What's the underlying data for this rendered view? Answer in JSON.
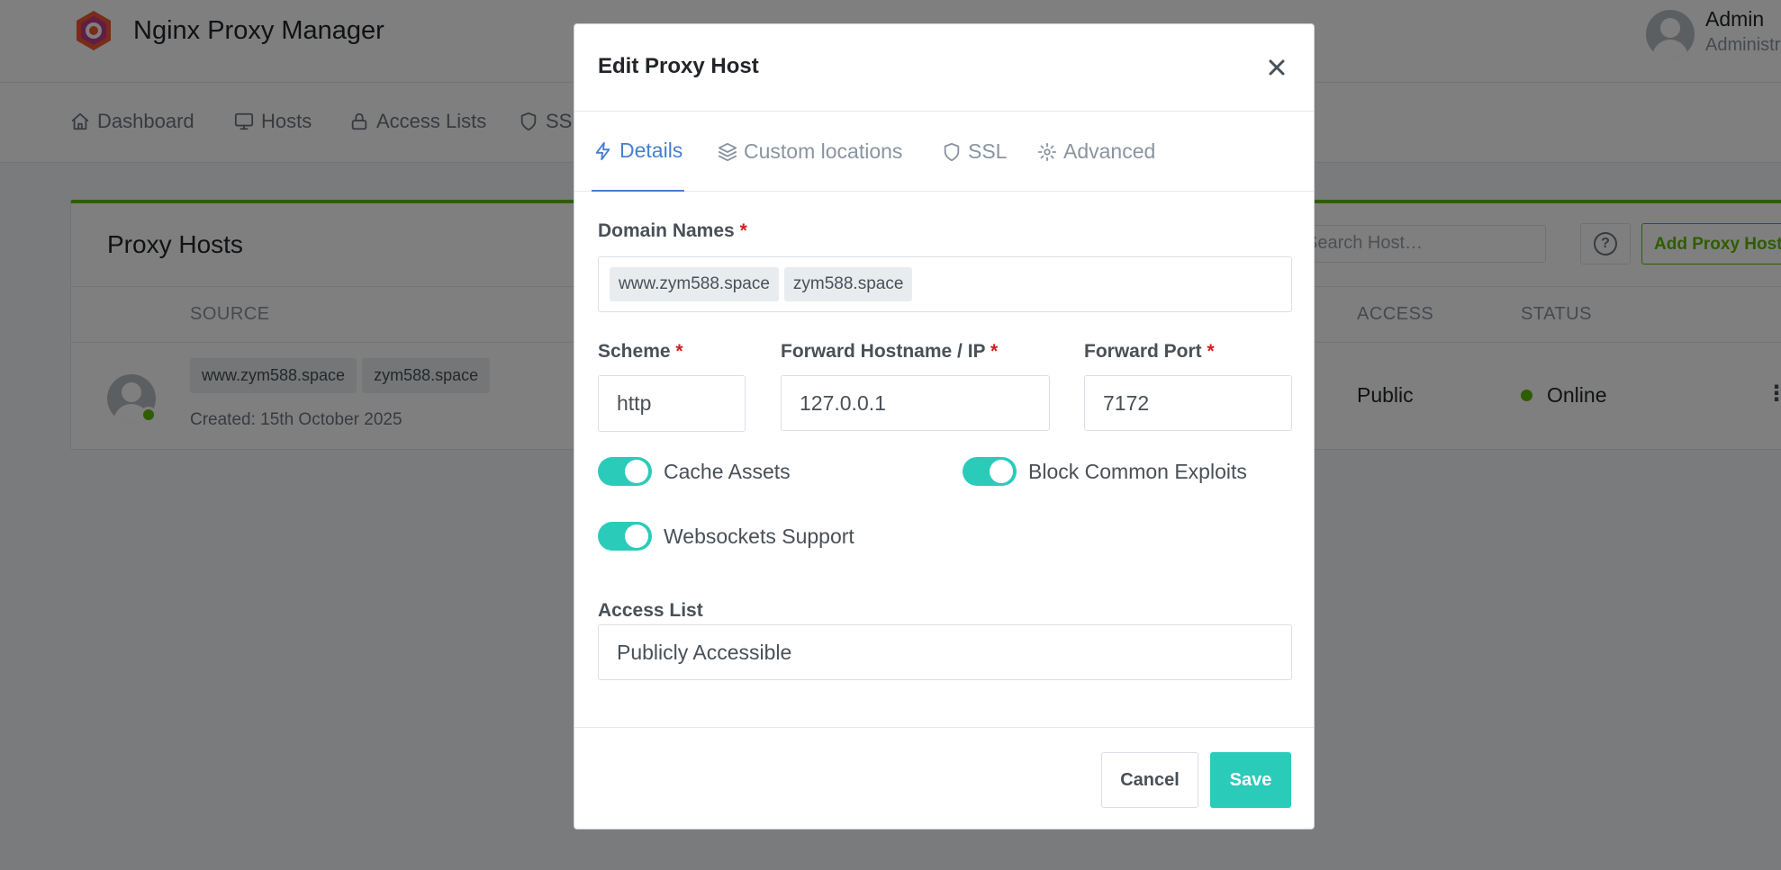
{
  "app": {
    "name": "Nginx Proxy Manager",
    "user": {
      "name": "Admin",
      "role": "Administrator"
    }
  },
  "nav": [
    {
      "label": "Dashboard",
      "icon": "home-icon"
    },
    {
      "label": "Hosts",
      "icon": "monitor-icon"
    },
    {
      "label": "Access Lists",
      "icon": "lock-icon"
    },
    {
      "label": "SSL",
      "icon": "shield-icon"
    }
  ],
  "card": {
    "title": "Proxy Hosts",
    "search_placeholder": "Search Host…",
    "help_label": "?",
    "add_label": "Add Proxy Host",
    "columns": {
      "source": "SOURCE",
      "access": "ACCESS",
      "status": "STATUS"
    },
    "row": {
      "domains": [
        "www.zym588.space",
        "zym588.space"
      ],
      "created": "Created: 15th October 2025",
      "access": "Public",
      "status": "Online",
      "menu": "⋮"
    }
  },
  "modal": {
    "title": "Edit Proxy Host",
    "tabs": [
      {
        "label": "Details",
        "icon": "bolt-icon",
        "active": true
      },
      {
        "label": "Custom locations",
        "icon": "layers-icon",
        "active": false
      },
      {
        "label": "SSL",
        "icon": "shield-icon",
        "active": false
      },
      {
        "label": "Advanced",
        "icon": "gear-icon",
        "active": false
      }
    ],
    "domain_names": {
      "label": "Domain Names",
      "required": "*",
      "values": [
        "www.zym588.space",
        "zym588.space"
      ]
    },
    "scheme": {
      "label": "Scheme",
      "required": "*",
      "value": "http"
    },
    "forward_host": {
      "label": "Forward Hostname / IP",
      "required": "*",
      "value": "127.0.0.1"
    },
    "forward_port": {
      "label": "Forward Port",
      "required": "*",
      "value": "7172"
    },
    "toggles": {
      "cache_assets": {
        "label": "Cache Assets",
        "on": true
      },
      "block_exploits": {
        "label": "Block Common Exploits",
        "on": true
      },
      "websockets": {
        "label": "Websockets Support",
        "on": true
      }
    },
    "access_list": {
      "label": "Access List",
      "value": "Publicly Accessible"
    },
    "buttons": {
      "cancel": "Cancel",
      "save": "Save"
    }
  },
  "colors": {
    "accent_green": "#5eba00",
    "accent_teal": "#2bcbba",
    "tab_active": "#467fcf",
    "required": "#cd201f"
  }
}
